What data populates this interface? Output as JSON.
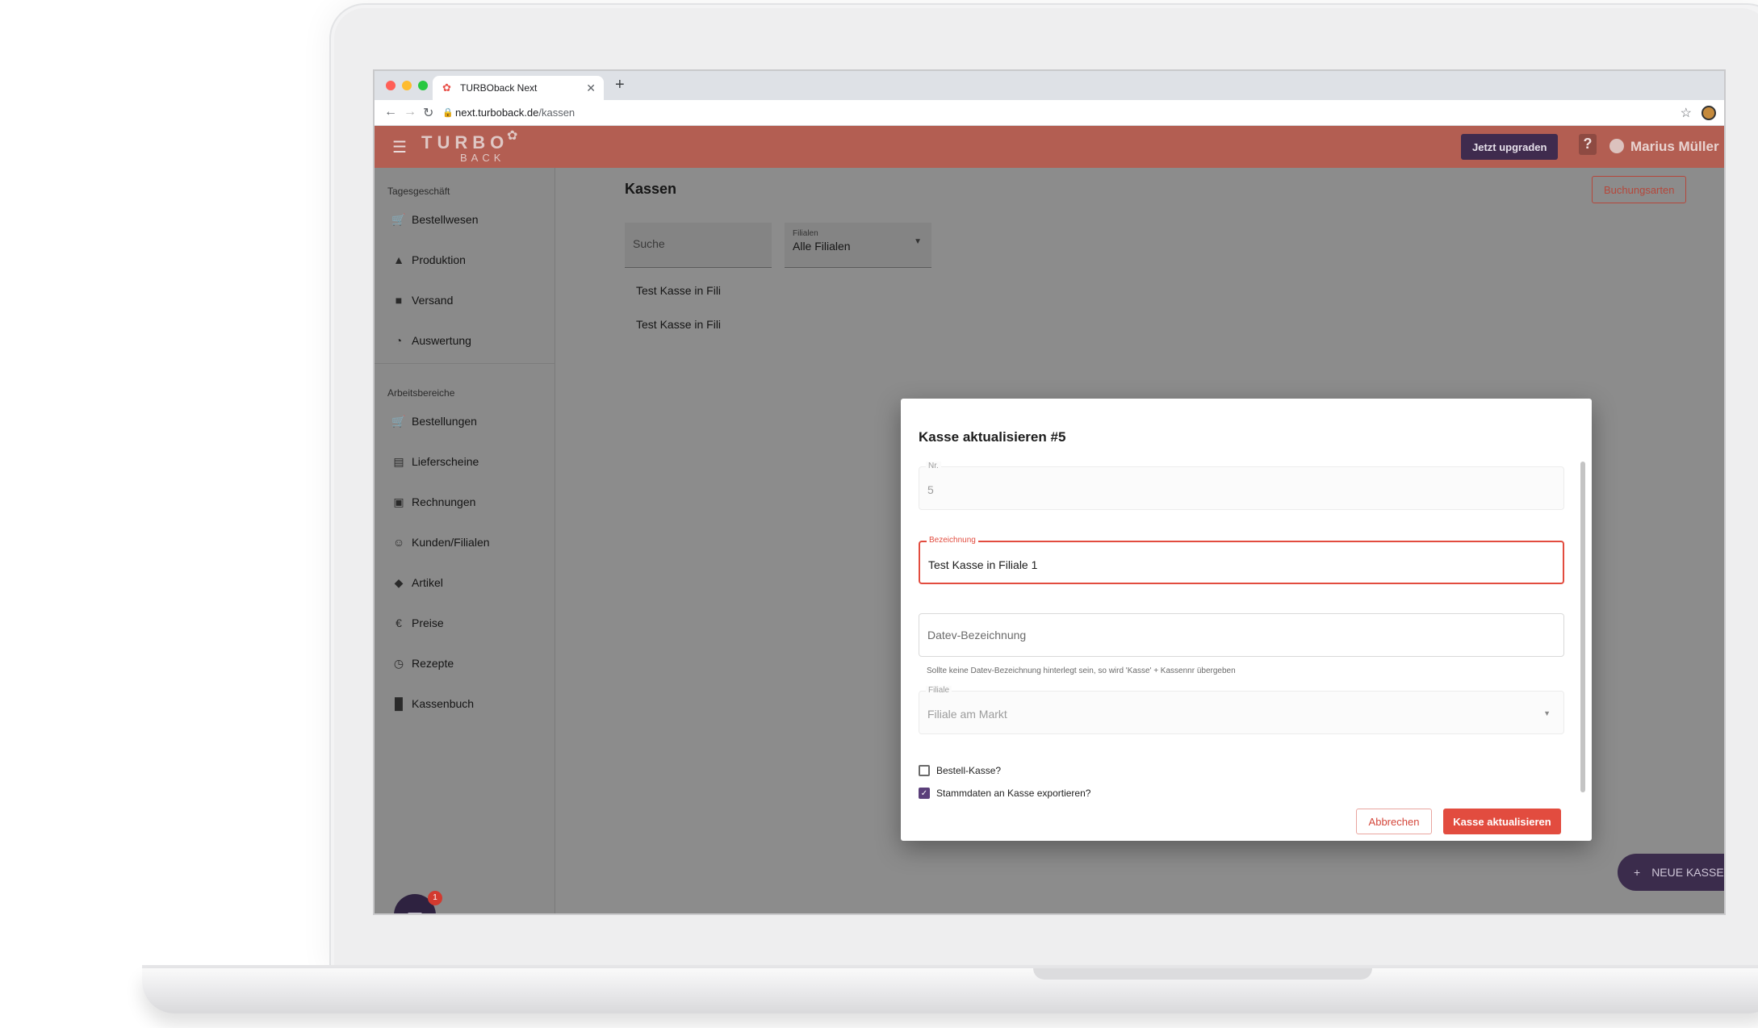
{
  "browser": {
    "tab_title": "TURBOback Next",
    "url_host": "next.turboback.de",
    "url_path": "/kassen"
  },
  "header": {
    "logo_main": "TURBO",
    "logo_sub": "BACK",
    "upgrade_label": "Jetzt upgraden",
    "help_label": "?",
    "user_name": "Marius Müller"
  },
  "sidebar": {
    "section1": "Tagesgeschäft",
    "items1": [
      {
        "label": "Bestellwesen",
        "icon": "cart-icon"
      },
      {
        "label": "Produktion",
        "icon": "production-icon"
      },
      {
        "label": "Versand",
        "icon": "truck-icon"
      },
      {
        "label": "Auswertung",
        "icon": "pie-chart-icon"
      }
    ],
    "section2": "Arbeitsbereiche",
    "items2": [
      {
        "label": "Bestellungen",
        "icon": "cart-icon"
      },
      {
        "label": "Lieferscheine",
        "icon": "calendar-icon"
      },
      {
        "label": "Rechnungen",
        "icon": "wallet-icon"
      },
      {
        "label": "Kunden/Filialen",
        "icon": "person-icon"
      },
      {
        "label": "Artikel",
        "icon": "tag-icon"
      },
      {
        "label": "Preise",
        "icon": "euro-icon"
      },
      {
        "label": "Rezepte",
        "icon": "clock-icon"
      },
      {
        "label": "Kassenbuch",
        "icon": "book-icon"
      }
    ],
    "chat_badge": "1"
  },
  "main": {
    "title": "Kassen",
    "buchungsarten_label": "Buchungsarten",
    "search_placeholder": "Suche",
    "filter_label": "Filialen",
    "filter_value": "Alle Filialen",
    "rows": [
      "Test Kasse in Fili",
      "Test Kasse in Fili"
    ],
    "fab_label": "NEUE KASSE"
  },
  "modal": {
    "title": "Kasse aktualisieren #5",
    "nr_label": "Nr.",
    "nr_value": "5",
    "bezeichnung_label": "Bezeichnung",
    "bezeichnung_value": "Test Kasse in Filiale 1",
    "datev_placeholder": "Datev-Bezeichnung",
    "datev_helper": "Sollte keine Datev-Bezeichnung hinterlegt sein, so wird 'Kasse' + Kassennr übergeben",
    "filiale_label": "Filiale",
    "filiale_value": "Filiale am Markt",
    "checkbox1_label": "Bestell-Kasse?",
    "checkbox1_checked": false,
    "checkbox2_label": "Stammdaten an Kasse exportieren?",
    "checkbox2_checked": true,
    "cancel_label": "Abbrechen",
    "submit_label": "Kasse aktualisieren"
  },
  "colors": {
    "brand_header": "#b35e52",
    "accent_red": "#e24c3f",
    "purple": "#3f2b4e"
  }
}
